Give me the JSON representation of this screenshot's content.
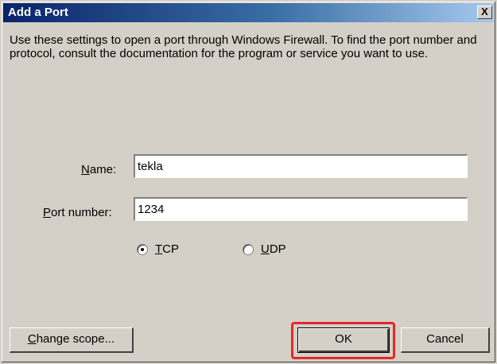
{
  "window": {
    "title": "Add a Port",
    "close_glyph": "X"
  },
  "description": "Use these settings to open a port through Windows Firewall. To find the port number and protocol, consult the documentation for the program or service you want to use.",
  "form": {
    "name_label_mnemonic": "N",
    "name_label_rest": "ame:",
    "name_value": "tekla",
    "port_label_mnemonic": "P",
    "port_label_rest": "ort number:",
    "port_value": "1234"
  },
  "protocol": {
    "selected": "TCP",
    "tcp_mnemonic": "T",
    "tcp_rest": "CP",
    "udp_mnemonic": "U",
    "udp_rest": "DP"
  },
  "buttons": {
    "change_scope_mnemonic": "C",
    "change_scope_rest": "hange scope...",
    "ok_label": "OK",
    "cancel_label": "Cancel"
  },
  "colors": {
    "dialog_face": "#d4d0c8",
    "titlebar_start": "#0a246a",
    "titlebar_end": "#a6caf0",
    "highlight_ring": "#e8262a"
  },
  "icons": {
    "close": "close-icon",
    "radio_selected": "radio-selected-icon",
    "radio_unselected": "radio-unselected-icon"
  }
}
